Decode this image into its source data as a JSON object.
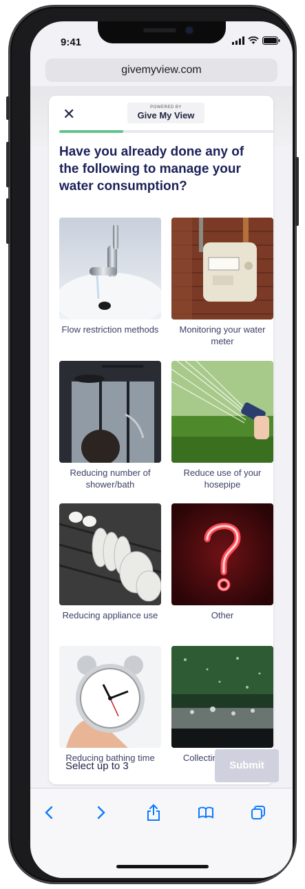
{
  "status": {
    "time": "9:41"
  },
  "browser": {
    "url": "givemyview.com"
  },
  "header": {
    "powered_by": "POWERED BY",
    "brand": "Give My View",
    "close_symbol": "✕"
  },
  "progress": {
    "fraction": 0.3
  },
  "question": {
    "text": "Have you already done any of the following to manage your water consumption?"
  },
  "options": [
    {
      "label": "Flow restriction methods",
      "image": "tap-photo"
    },
    {
      "label": "Monitoring your water meter",
      "image": "water-meter-photo"
    },
    {
      "label": "Reducing number of shower/bath",
      "image": "shower-photo"
    },
    {
      "label": "Reduce use of your hosepipe",
      "image": "hosepipe-photo"
    },
    {
      "label": "Reducing appliance use",
      "image": "dishwasher-photo"
    },
    {
      "label": "Other",
      "image": "neon-question-mark-photo"
    },
    {
      "label": "Reducing bathing time",
      "image": "alarm-clock-photo"
    },
    {
      "label": "Collecting rainwater",
      "image": "rainwater-photo"
    }
  ],
  "footer": {
    "hint": "Select up to 3",
    "submit_label": "Submit"
  },
  "colors": {
    "accent_green": "#5ec48a",
    "title_navy": "#1b2159",
    "submit_disabled": "#cfd1de",
    "ios_blue": "#0a7aff"
  }
}
